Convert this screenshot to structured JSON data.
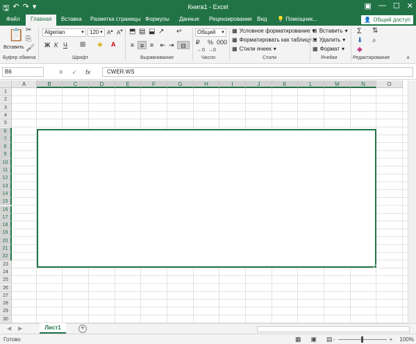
{
  "window": {
    "title": "Книга1 - Excel",
    "qa_icons": [
      "save-icon",
      "undo-icon",
      "redo-icon",
      "customize-icon"
    ],
    "win_icons": [
      "ribbon-options-icon",
      "minimize-icon",
      "maximize-icon",
      "close-icon"
    ]
  },
  "tabs": [
    {
      "label": "Файл"
    },
    {
      "label": "Главная"
    },
    {
      "label": "Вставка"
    },
    {
      "label": "Разметка страницы"
    },
    {
      "label": "Формулы"
    },
    {
      "label": "Данные"
    },
    {
      "label": "Рецензирование"
    },
    {
      "label": "Вид"
    },
    {
      "label": "Помощник..."
    }
  ],
  "share_label": "Общий доступ",
  "ribbon": {
    "groups": [
      "Буфер обмена",
      "Шрифт",
      "Выравнивание",
      "Число",
      "Стили",
      "Ячейки",
      "Редактирование"
    ],
    "paste_label": "Вставить",
    "font": {
      "name": "Algerian",
      "size": "120"
    },
    "bold": "Ж",
    "italic": "К",
    "underline": "Ч",
    "number_format": "Общий",
    "styles": {
      "conditional": "Условное форматирование",
      "format_table": "Форматировать как таблицу",
      "cell_styles": "Стили ячеек"
    },
    "cells": {
      "insert": "Вставить",
      "delete": "Удалить",
      "format": "Формат"
    }
  },
  "formula_bar": {
    "name_box": "B6",
    "fx": "fx",
    "value": "CWER.WS"
  },
  "grid": {
    "columns": [
      "A",
      "B",
      "C",
      "D",
      "E",
      "F",
      "G",
      "H",
      "I",
      "J",
      "K",
      "L",
      "M",
      "N",
      "O"
    ],
    "rows": [
      "1",
      "2",
      "3",
      "4",
      "5",
      "6",
      "7",
      "8",
      "9",
      "10",
      "11",
      "12",
      "13",
      "14",
      "15",
      "16",
      "17",
      "18",
      "19",
      "20",
      "21",
      "22",
      "23",
      "24",
      "25",
      "26",
      "27",
      "28",
      "29",
      "30"
    ]
  },
  "sheet": {
    "tab": "Лист1",
    "add": "+"
  },
  "status": {
    "text": "Готово",
    "zoom": "100%",
    "zoom_minus": "-",
    "zoom_plus": "+"
  },
  "colors": {
    "accent": "#217346"
  }
}
